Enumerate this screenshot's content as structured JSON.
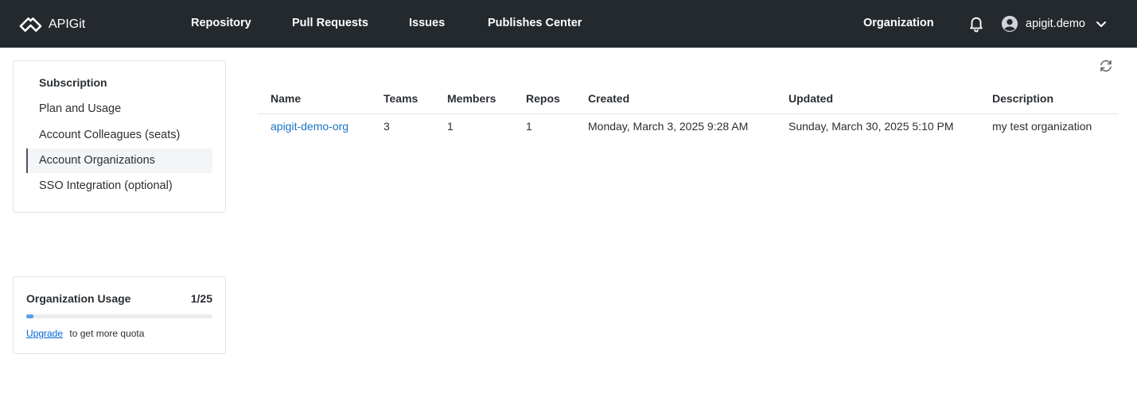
{
  "header": {
    "brand": "APIGit",
    "nav": [
      "Repository",
      "Pull Requests",
      "Issues",
      "Publishes Center"
    ],
    "organization": "Organization",
    "user": "apigit.demo"
  },
  "sidebar": {
    "title": "Subscription",
    "items": [
      {
        "label": "Plan and Usage",
        "active": false
      },
      {
        "label": "Account Colleagues (seats)",
        "active": false
      },
      {
        "label": "Account Organizations",
        "active": true
      },
      {
        "label": "SSO Integration (optional)",
        "active": false
      }
    ]
  },
  "usage": {
    "title": "Organization Usage",
    "count": "1/25",
    "progress": 0.04,
    "upgrade_link": "Upgrade",
    "note": "to get more quota"
  },
  "table": {
    "columns": [
      "Name",
      "Teams",
      "Members",
      "Repos",
      "Created",
      "Updated",
      "Description"
    ],
    "rows": [
      [
        "apigit-demo-org",
        "3",
        "1",
        "1",
        "Monday, March 3, 2025 9:28 AM",
        "Sunday, March 30, 2025 5:10 PM",
        "my test organization"
      ]
    ]
  },
  "icons": {
    "brand": "apigit-logo-icon",
    "bell": "bell-icon",
    "avatar": "user-circle-icon",
    "chevron": "chevron-down-icon",
    "refresh": "refresh-icon"
  },
  "colors": {
    "topbar": "#24292e",
    "link": "#1a73c6",
    "progress": "#5aa0e6"
  }
}
